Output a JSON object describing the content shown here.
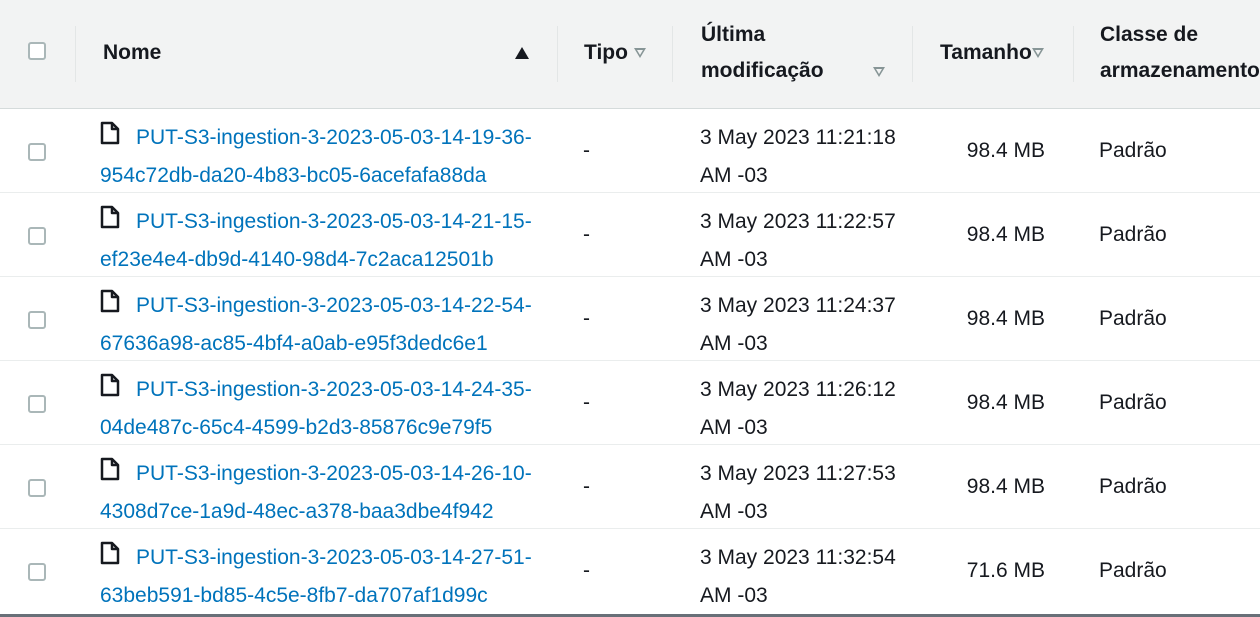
{
  "header": {
    "name_label": "Nome",
    "type_label": "Tipo",
    "modified_label_line1": "Última",
    "modified_label_line2": "modificação",
    "size_label": "Tamanho",
    "class_label_line1": "Classe de",
    "class_label_line2": "armazenamento"
  },
  "rows": [
    {
      "name": "PUT-S3-ingestion-3-2023-05-03-14-19-36-954c72db-da20-4b83-bc05-6acefafa88da",
      "type": "-",
      "modified_line1": "3 May 2023 11:21:18",
      "modified_line2": "AM -03",
      "size": "98.4 MB",
      "storage_class": "Padrão"
    },
    {
      "name": "PUT-S3-ingestion-3-2023-05-03-14-21-15-ef23e4e4-db9d-4140-98d4-7c2aca12501b",
      "type": "-",
      "modified_line1": "3 May 2023 11:22:57",
      "modified_line2": "AM -03",
      "size": "98.4 MB",
      "storage_class": "Padrão"
    },
    {
      "name": "PUT-S3-ingestion-3-2023-05-03-14-22-54-67636a98-ac85-4bf4-a0ab-e95f3dedc6e1",
      "type": "-",
      "modified_line1": "3 May 2023 11:24:37",
      "modified_line2": "AM -03",
      "size": "98.4 MB",
      "storage_class": "Padrão"
    },
    {
      "name": "PUT-S3-ingestion-3-2023-05-03-14-24-35-04de487c-65c4-4599-b2d3-85876c9e79f5",
      "type": "-",
      "modified_line1": "3 May 2023 11:26:12",
      "modified_line2": "AM -03",
      "size": "98.4 MB",
      "storage_class": "Padrão"
    },
    {
      "name": "PUT-S3-ingestion-3-2023-05-03-14-26-10-4308d7ce-1a9d-48ec-a378-baa3dbe4f942",
      "type": "-",
      "modified_line1": "3 May 2023 11:27:53",
      "modified_line2": "AM -03",
      "size": "98.4 MB",
      "storage_class": "Padrão"
    },
    {
      "name": "PUT-S3-ingestion-3-2023-05-03-14-27-51-63beb591-bd85-4c5e-8fb7-da707af1d99c",
      "type": "-",
      "modified_line1": "3 May 2023 11:32:54",
      "modified_line2": "AM -03",
      "size": "71.6 MB",
      "storage_class": "Padrão"
    }
  ],
  "colors": {
    "link": "#0073bb",
    "header_bg": "#f2f3f3",
    "text": "#16191f"
  },
  "icons": {
    "file": "file-icon",
    "sort_asc": "sort-ascending-icon",
    "sort_desc": "sort-descending-icon"
  }
}
